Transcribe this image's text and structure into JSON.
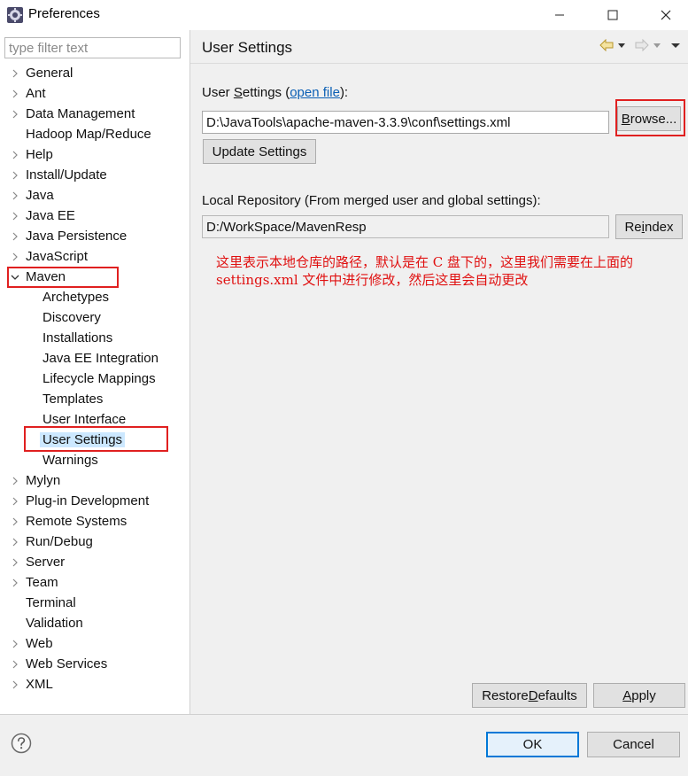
{
  "window": {
    "title": "Preferences",
    "icon": "eclipse-gear-icon",
    "controls": [
      "minimize-icon",
      "maximize-icon",
      "close-icon"
    ]
  },
  "filter": {
    "placeholder": "type filter text",
    "value": ""
  },
  "tree": [
    {
      "label": "General",
      "expandable": true
    },
    {
      "label": "Ant",
      "expandable": true
    },
    {
      "label": "Data Management",
      "expandable": true
    },
    {
      "label": "Hadoop Map/Reduce",
      "expandable": false
    },
    {
      "label": "Help",
      "expandable": true
    },
    {
      "label": "Install/Update",
      "expandable": true
    },
    {
      "label": "Java",
      "expandable": true
    },
    {
      "label": "Java EE",
      "expandable": true
    },
    {
      "label": "Java Persistence",
      "expandable": true
    },
    {
      "label": "JavaScript",
      "expandable": true
    },
    {
      "label": "Maven",
      "expandable": true,
      "expanded": true
    },
    {
      "label": "Archetypes",
      "child": true
    },
    {
      "label": "Discovery",
      "child": true
    },
    {
      "label": "Installations",
      "child": true
    },
    {
      "label": "Java EE Integration",
      "child": true
    },
    {
      "label": "Lifecycle Mappings",
      "child": true
    },
    {
      "label": "Templates",
      "child": true
    },
    {
      "label": "User Interface",
      "child": true
    },
    {
      "label": "User Settings",
      "child": true,
      "selected": true
    },
    {
      "label": "Warnings",
      "child": true
    },
    {
      "label": "Mylyn",
      "expandable": true
    },
    {
      "label": "Plug-in Development",
      "expandable": true
    },
    {
      "label": "Remote Systems",
      "expandable": true
    },
    {
      "label": "Run/Debug",
      "expandable": true
    },
    {
      "label": "Server",
      "expandable": true
    },
    {
      "label": "Team",
      "expandable": true
    },
    {
      "label": "Terminal",
      "expandable": false
    },
    {
      "label": "Validation",
      "expandable": false
    },
    {
      "label": "Web",
      "expandable": true
    },
    {
      "label": "Web Services",
      "expandable": true
    },
    {
      "label": "XML",
      "expandable": true
    }
  ],
  "page": {
    "title": "User Settings",
    "nav_icons": [
      "back-arrow-icon",
      "back-dropdown-icon",
      "forward-arrow-icon",
      "forward-dropdown-icon",
      "view-menu-icon"
    ],
    "user_settings_label_pre": "User ",
    "user_settings_label_mn": "S",
    "user_settings_label_mid": "ettings (",
    "open_file_link": "open file",
    "user_settings_label_post": "):",
    "user_settings_value": "D:\\JavaTools\\apache-maven-3.3.9\\conf\\settings.xml",
    "browse_pre": "",
    "browse_mn": "B",
    "browse_post": "rowse...",
    "update_settings": "Update Settings",
    "local_repo_label": "Local Repository (From merged user and global settings):",
    "local_repo_value": "D:/WorkSpace/MavenResp",
    "reindex_pre": "Re",
    "reindex_mn": "i",
    "reindex_post": "ndex",
    "annotation": "这里表示本地仓库的路径，默认是在 C 盘下的，这里我们需要在上面的 settings.xml 文件中进行修改，然后这里会自动更改",
    "restore_pre": "Restore ",
    "restore_mn": "D",
    "restore_post": "efaults",
    "apply_pre": "",
    "apply_mn": "A",
    "apply_post": "pply"
  },
  "footer": {
    "help_icon": "help-question-icon",
    "ok": "OK",
    "cancel": "Cancel"
  },
  "colors": {
    "annotation_red": "#e02020",
    "link_blue": "#0b5fb5",
    "selection": "#cce8ff",
    "primary_border": "#0078d7"
  }
}
